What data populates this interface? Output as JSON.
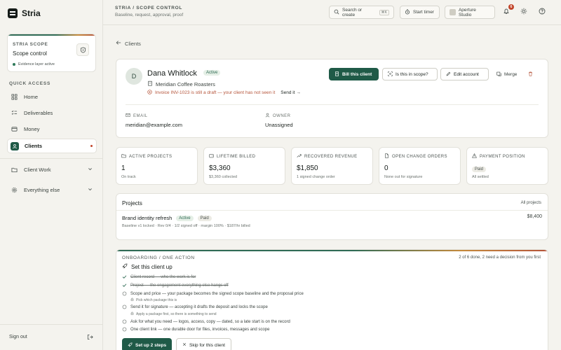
{
  "app": {
    "name": "Stria"
  },
  "sidebar": {
    "scope_card": {
      "eyebrow": "STRIA SCOPE",
      "title": "Scope control",
      "status": "Evidence layer active"
    },
    "quick_access_label": "QUICK ACCESS",
    "items": [
      {
        "label": "Home",
        "icon": "home-icon"
      },
      {
        "label": "Deliverables",
        "icon": "deliverables-icon"
      },
      {
        "label": "Money",
        "icon": "money-icon"
      },
      {
        "label": "Clients",
        "icon": "clients-icon",
        "active": true
      }
    ],
    "groups": [
      {
        "label": "Client Work",
        "icon": "folder-icon"
      },
      {
        "label": "Everything else",
        "icon": "gear-icon"
      }
    ],
    "sign_out": "Sign out"
  },
  "topbar": {
    "breadcrumb": "STRIA / SCOPE CONTROL",
    "subtitle": "Baseline, request, approval, proof",
    "search_label": "Search or create",
    "search_shortcut": "⌘K",
    "timer_label": "Start timer",
    "workspace": "Aperture Studio",
    "notifications_count": "6"
  },
  "back_link": "Clients",
  "client": {
    "initial": "D",
    "name": "Dana Whitlock",
    "status": "Active",
    "company": "Meridian Coffee Roasters",
    "warning": "Invoice INV-1023 is still a draft — your client has not seen it",
    "warning_link": "Send it",
    "actions": {
      "bill": "Bill this client",
      "scope": "Is this in scope?",
      "edit": "Edit account",
      "merge": "Merge"
    },
    "email_label": "EMAIL",
    "email": "meridian@example.com",
    "owner_label": "OWNER",
    "owner": "Unassigned"
  },
  "stats": [
    {
      "label": "ACTIVE PROJECTS",
      "value": "1",
      "sub": "On track",
      "icon": "folder-icon"
    },
    {
      "label": "LIFETIME BILLED",
      "value": "$3,360",
      "sub": "$3,360 collected",
      "icon": "wallet-icon"
    },
    {
      "label": "RECOVERED REVENUE",
      "value": "$1,850",
      "sub": "1 signed change order",
      "icon": "trend-up-icon"
    },
    {
      "label": "OPEN CHANGE ORDERS",
      "value": "0",
      "sub": "None out for signature",
      "icon": "document-icon"
    },
    {
      "label": "PAYMENT POSITION",
      "value": "Paid",
      "sub": "All settled",
      "icon": "warning-icon"
    }
  ],
  "projects": {
    "title": "Projects",
    "all_link": "All projects",
    "rows": [
      {
        "name": "Brand identity refresh",
        "status": "Active",
        "payment": "Paid",
        "meta": "Baseline v1 locked · Rev 0/4 · 1/2 signed off · margin 100% · $187/hr billed",
        "amount": "$8,400"
      }
    ]
  },
  "onboarding": {
    "eyebrow": "ONBOARDING / ONE ACTION",
    "progress": "2 of 6 done, 2 need a decision from you first",
    "title": "Set this client up",
    "steps": [
      {
        "text": "Client record — who the work is for",
        "done": true
      },
      {
        "text": "Project — the engagement everything else hangs off",
        "done": true
      },
      {
        "text": "Scope and price — your package becomes the signed scope baseline and the proposal price",
        "done": false,
        "sub": "Pick which package this is"
      },
      {
        "text": "Send it for signature — accepting it drafts the deposit and locks the scope",
        "done": false,
        "sub": "Apply a package first, so there is something to send"
      },
      {
        "text": "Ask for what you need — logos, access, copy — dated, so a late start is on the record",
        "done": false
      },
      {
        "text": "One client link — one durable door for files, invoices, messages and scope",
        "done": false
      }
    ],
    "primary": "Set up 2 steps",
    "secondary": "Skip for this client"
  }
}
